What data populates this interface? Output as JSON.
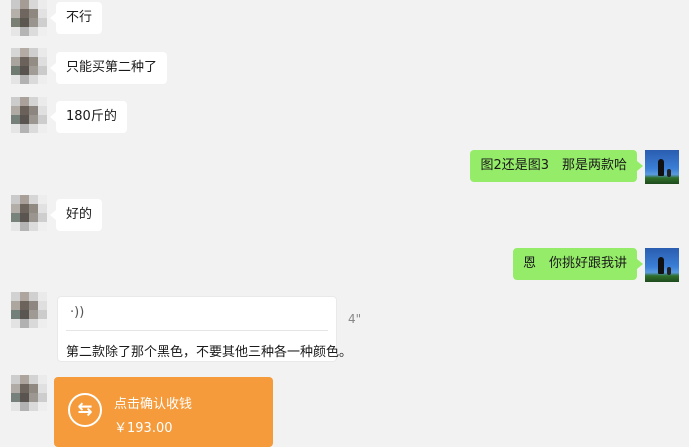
{
  "messages": [
    {
      "side": "left",
      "text": "不行"
    },
    {
      "side": "left",
      "text": "只能买第二种了"
    },
    {
      "side": "left",
      "text": "180斤的"
    },
    {
      "side": "right",
      "text": "图2还是图3　那是两款哈"
    },
    {
      "side": "left",
      "text": "好的"
    },
    {
      "side": "right",
      "text": "恩　你挑好跟我讲"
    }
  ],
  "voice": {
    "wave_glyph": "·))",
    "duration": "4\"",
    "transcript": "第二款除了那个黑色，不要其他三种各一种颜色。"
  },
  "payment": {
    "title": "点击确认收钱",
    "amount": "￥193.00",
    "icon": "transfer-arrows-icon",
    "color": "#f59b3b"
  },
  "colors": {
    "self_bubble": "#95ec69",
    "other_bubble": "#ffffff",
    "background": "#f2f2f2"
  }
}
